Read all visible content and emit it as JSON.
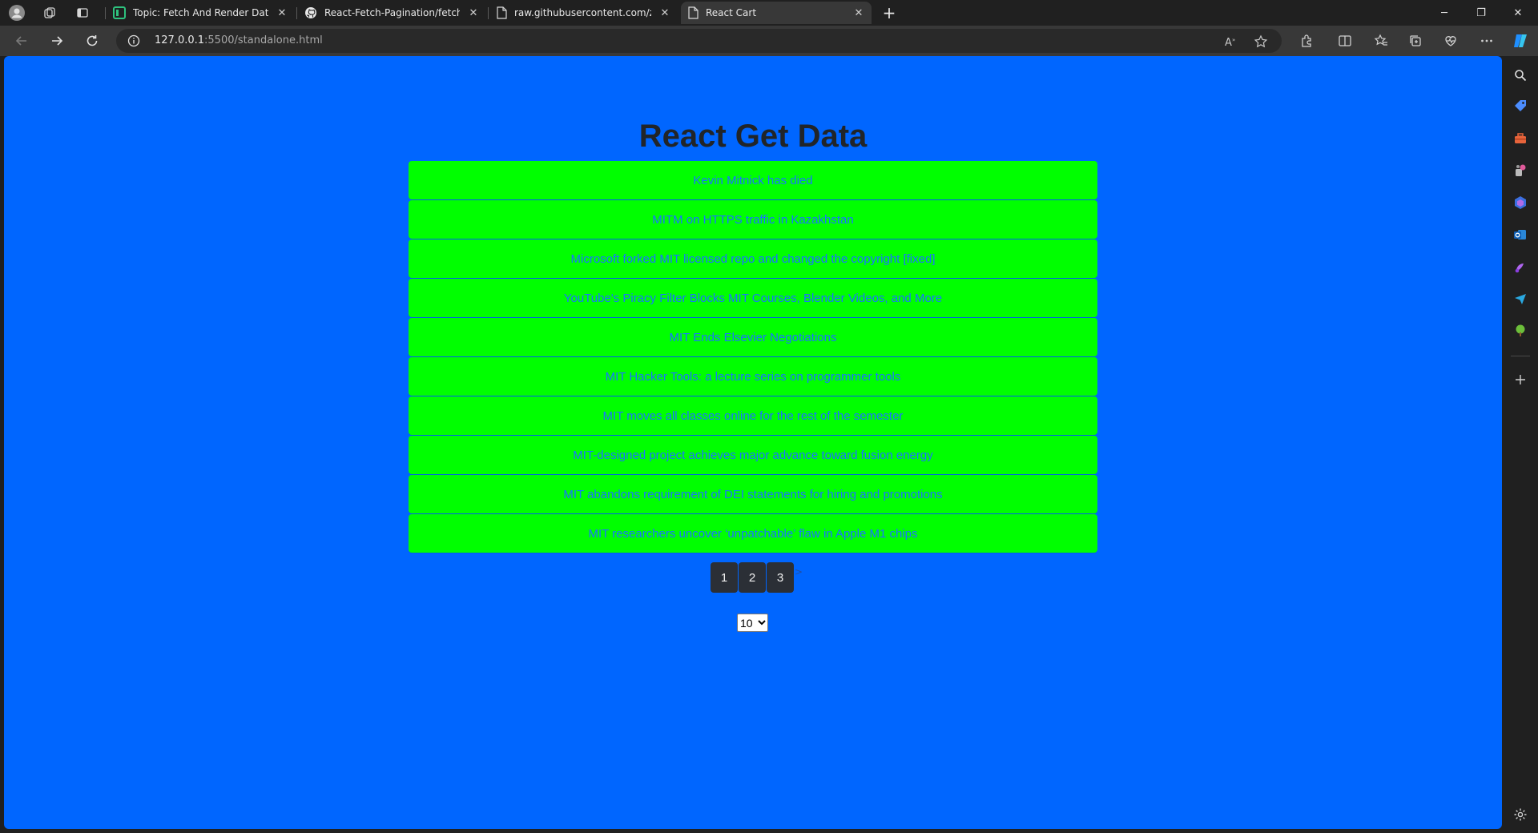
{
  "browser": {
    "tabs": [
      {
        "title": "Topic: Fetch And Render Data Co",
        "icon": "forum-icon",
        "active": false
      },
      {
        "title": "React-Fetch-Pagination/fetchDa",
        "icon": "github-icon",
        "active": false
      },
      {
        "title": "raw.githubusercontent.com/zor",
        "icon": "document-icon",
        "active": false
      },
      {
        "title": "React Cart",
        "icon": "document-icon",
        "active": true
      }
    ],
    "close_glyph": "✕",
    "new_tab_glyph": "+",
    "address": {
      "host": "127.0.0.1",
      "path": ":5500/standalone.html"
    },
    "window_controls": {
      "minimize": "─",
      "restore": "❐",
      "close": "✕"
    }
  },
  "page": {
    "title": "React Get Data",
    "items": [
      "Kevin Mitnick has died",
      "MITM on HTTPS traffic in Kazakhstan",
      "Microsoft forked MIT licensed repo and changed the copyright [fixed]",
      "YouTube's Piracy Filter Blocks MIT Courses, Blender Videos, and More",
      "MIT Ends Elsevier Negotiations",
      "MIT Hacker Tools: a lecture series on programmer tools",
      "MIT moves all classes online for the rest of the semester",
      "MIT-designed project achieves major advance toward fusion energy",
      "MIT abandons requirement of DEI statements for hiring and promotions",
      "MIT researchers uncover ‘unpatchable’ flaw in Apple M1 chips"
    ],
    "pages": [
      "1",
      "2",
      "3"
    ],
    "pager_tail": ">",
    "per_page": "10"
  },
  "colors": {
    "page_background": "#0066ff",
    "item_background": "#00ff00",
    "item_text": "#1a73ff",
    "pager_button": "#2b2f36"
  },
  "sidebar_icons": [
    "search-icon",
    "tag-icon",
    "toolbox-icon",
    "games-icon",
    "copilot-icon",
    "outlook-icon",
    "creative-icon",
    "send-icon",
    "tree-icon",
    "add-icon",
    "settings-icon"
  ]
}
